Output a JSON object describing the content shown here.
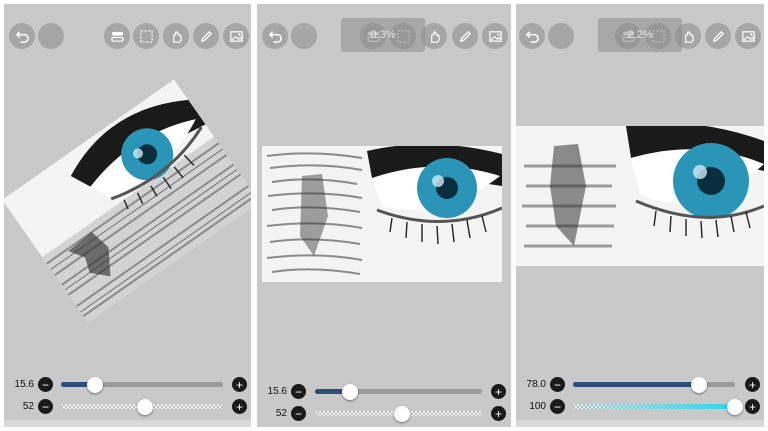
{
  "panels": [
    {
      "id": "p1",
      "sliders": [
        {
          "value": "15.6",
          "fraction": 0.21,
          "style": "solid"
        },
        {
          "value": "52",
          "fraction": 0.52,
          "style": "checker"
        }
      ]
    },
    {
      "id": "p2",
      "overlay": "0.3%",
      "sliders": [
        {
          "value": "15.6",
          "fraction": 0.21,
          "style": "solid"
        },
        {
          "value": "52",
          "fraction": 0.52,
          "style": "checker"
        }
      ]
    },
    {
      "id": "p3",
      "overlay": "2.2%",
      "sliders": [
        {
          "value": "78.0",
          "fraction": 0.78,
          "style": "solid"
        },
        {
          "value": "100",
          "fraction": 1.0,
          "style": "cyan"
        }
      ]
    }
  ],
  "icons": {
    "undo": "undo-icon",
    "color": "color-swatch",
    "layer_toggle": "layer-toggle-icon",
    "selection": "selection-icon",
    "transform": "transform-hand-icon",
    "brush": "pencil-icon",
    "image": "image-icon"
  },
  "colors": {
    "workspace": "#c9c9c9",
    "slider_fill": "#2d4e7a",
    "eye_iris": "#2a95b6",
    "opacity_accent": "#2fd4ec"
  }
}
